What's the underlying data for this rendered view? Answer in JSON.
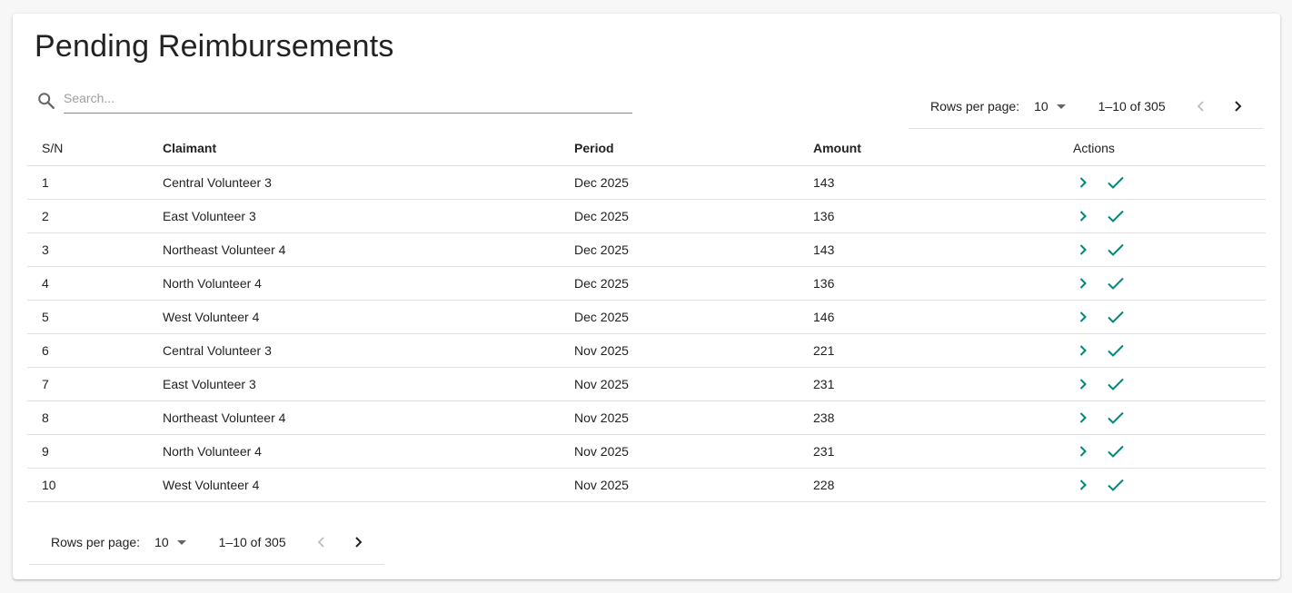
{
  "page": {
    "title": "Pending Reimbursements"
  },
  "search": {
    "placeholder": "Search...",
    "value": ""
  },
  "pagination": {
    "rows_per_page_label": "Rows per page:",
    "rows_per_page": "10",
    "range": "1–10 of 305"
  },
  "table": {
    "headers": {
      "sn": "S/N",
      "claimant": "Claimant",
      "period": "Period",
      "amount": "Amount",
      "actions": "Actions"
    },
    "rows": [
      {
        "sn": "1",
        "claimant": "Central Volunteer 3",
        "period": "Dec 2025",
        "amount": "143"
      },
      {
        "sn": "2",
        "claimant": "East Volunteer 3",
        "period": "Dec 2025",
        "amount": "136"
      },
      {
        "sn": "3",
        "claimant": "Northeast Volunteer 4",
        "period": "Dec 2025",
        "amount": "143"
      },
      {
        "sn": "4",
        "claimant": "North Volunteer 4",
        "period": "Dec 2025",
        "amount": "136"
      },
      {
        "sn": "5",
        "claimant": "West Volunteer 4",
        "period": "Dec 2025",
        "amount": "146"
      },
      {
        "sn": "6",
        "claimant": "Central Volunteer 3",
        "period": "Nov 2025",
        "amount": "221"
      },
      {
        "sn": "7",
        "claimant": "East Volunteer 3",
        "period": "Nov 2025",
        "amount": "231"
      },
      {
        "sn": "8",
        "claimant": "Northeast Volunteer 4",
        "period": "Nov 2025",
        "amount": "238"
      },
      {
        "sn": "9",
        "claimant": "North Volunteer 4",
        "period": "Nov 2025",
        "amount": "231"
      },
      {
        "sn": "10",
        "claimant": "West Volunteer 4",
        "period": "Nov 2025",
        "amount": "228"
      }
    ],
    "row_actions": [
      {
        "icon": "chevron-right-icon",
        "name": "view-details"
      },
      {
        "icon": "check-icon",
        "name": "approve"
      }
    ]
  },
  "colors": {
    "accent": "#00897b",
    "text": "#222222",
    "divider": "#e0e0e0",
    "disabled": "#bdbdbd"
  }
}
